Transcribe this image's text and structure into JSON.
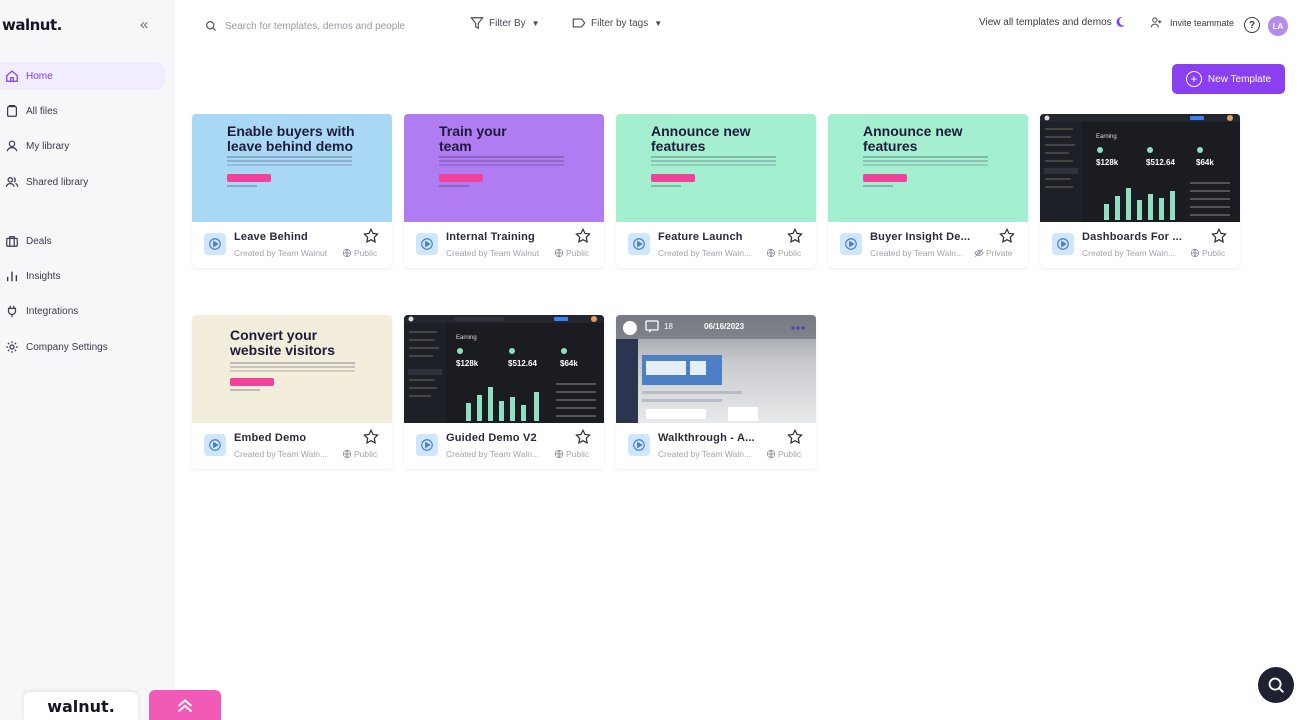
{
  "brand": "walnut.",
  "collapse_icon": "«",
  "sidebar": {
    "items": [
      {
        "label": "Home",
        "icon": "home-icon"
      },
      {
        "label": "All files",
        "icon": "files-icon"
      },
      {
        "label": "My library",
        "icon": "user-icon"
      },
      {
        "label": "Shared library",
        "icon": "users-icon"
      },
      {
        "label": "Deals",
        "icon": "briefcase-icon"
      },
      {
        "label": "Insights",
        "icon": "bar-chart-icon"
      },
      {
        "label": "Integrations",
        "icon": "plug-icon"
      },
      {
        "label": "Company Settings",
        "icon": "gear-icon"
      }
    ]
  },
  "search": {
    "placeholder": "Search for templates, demos and people"
  },
  "filters": {
    "filter_by": "Filter By",
    "filter_tags": "Filter by tags"
  },
  "header": {
    "view_all": "View all templates and demos",
    "invite": "Invite teammate",
    "help": "?",
    "avatar": "LA"
  },
  "new_template_label": "New Template",
  "cards": [
    {
      "name": "Leave Behind",
      "creator": "Created by Team Walnut",
      "visibility": "Public",
      "thumb_title": "Enable buyers with leave behind demo",
      "thumb_color": "#a9d8f5"
    },
    {
      "name": "Internal Training",
      "creator": "Created by Team Walnut",
      "visibility": "Public",
      "thumb_title": "Train your team",
      "thumb_color": "#b07cf2"
    },
    {
      "name": "Feature Launch",
      "creator": "Created by Team Waln...",
      "visibility": "Public",
      "thumb_title": "Announce new features",
      "thumb_color": "#a3efcf"
    },
    {
      "name": "Buyer Insight De...",
      "creator": "Created by Team Waln...",
      "visibility": "Private",
      "thumb_title": "Announce new features",
      "thumb_color": "#a3efcf"
    },
    {
      "name": "Dashboards For ...",
      "creator": "Created by Team Waln...",
      "visibility": "Public",
      "thumb_title": "",
      "thumb_color": "#1a1c22"
    },
    {
      "name": "Embed Demo",
      "creator": "Created by Team Waln...",
      "visibility": "Public",
      "thumb_title": "Convert your website visitors",
      "thumb_color": "#f3eedb"
    },
    {
      "name": "Guided Demo V2",
      "creator": "Created by Team Waln...",
      "visibility": "Public",
      "thumb_title": "",
      "thumb_color": "#1a1c22"
    },
    {
      "name": "Walkthrough - A...",
      "creator": "Created by Team Waln...",
      "visibility": "Public",
      "thumb_title": "",
      "thumb_color": "#a0a3ab"
    }
  ],
  "dash_thumb": {
    "heading": "Earning",
    "kpis": [
      "$128k",
      "$512.64",
      "$64k"
    ]
  },
  "walkthrough_thumb": {
    "count": "18",
    "date": "06/16/2023"
  },
  "colors": {
    "accent": "#8a3ff0",
    "pink": "#f25ab8",
    "sidebar_bg": "#f7f7f9"
  }
}
